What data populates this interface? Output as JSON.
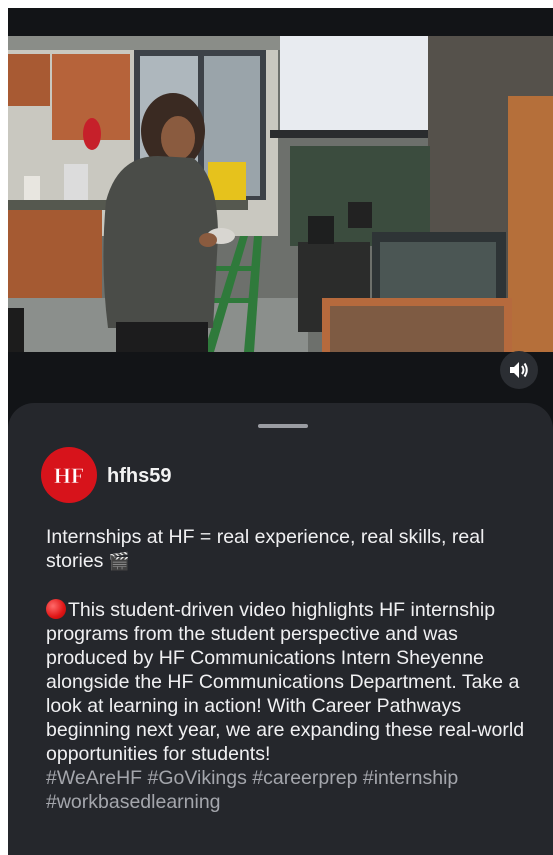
{
  "video": {
    "muted_icon": "speaker-icon"
  },
  "post": {
    "avatar_logo": "HF",
    "username": "hfhs59",
    "headline": "Internships at HF = real experience, real skills, real stories",
    "headline_emoji": "🎬",
    "body": "This student-driven video highlights HF internship programs from the student perspective and was produced by HF Communications Intern Sheyenne alongside the HF Communications Department. Take a look at learning in action! With Career Pathways beginning next year, we are expanding these real-world opportunities for students!",
    "hashtags": "#WeAreHF #GoVikings #careerprep #internship #workbasedlearning"
  },
  "colors": {
    "brand_red": "#d7131b",
    "sheet_bg": "#25272c",
    "hashtag": "#a4a6ac"
  }
}
